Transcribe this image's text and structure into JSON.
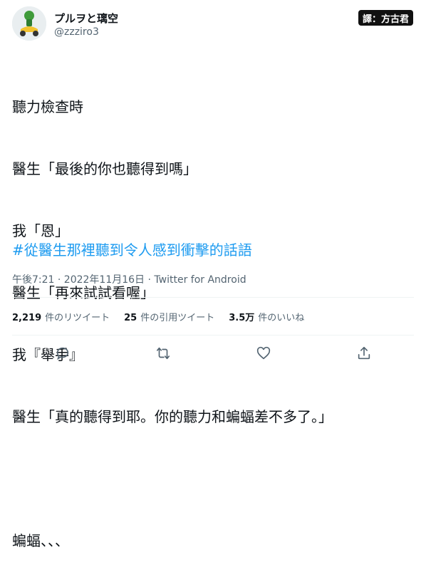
{
  "user": {
    "display_name": "プルヲと璃空",
    "handle": "@zzziro3",
    "avatar_icon": "scooter-character-avatar"
  },
  "watermark": {
    "label": "譯：方古君"
  },
  "tweet": {
    "lines": [
      "聽力檢查時",
      "醫生「最後的你也聽得到嗎」",
      "我「恩」",
      "醫生「再來試試看喔」",
      "我『舉手』",
      "醫生「真的聽得到耶。你的聽力和蝙蝠差不多了。」",
      "",
      "蝙蝠、、、"
    ],
    "hashtag": "#從醫生那裡聽到令人感到衝擊的話語",
    "timestamp": "午後7:21 · 2022年11月16日 · Twitter for Android"
  },
  "stats": {
    "retweets_count": "2,219",
    "retweets_label": "件のリツイート",
    "quotes_count": "25",
    "quotes_label": "件の引用ツイート",
    "likes_count": "3.5万",
    "likes_label": "件のいいね"
  },
  "actions": {
    "icons": [
      "reply-icon",
      "retweet-icon",
      "like-icon",
      "share-icon"
    ]
  },
  "colors": {
    "accent": "#1d9bf0",
    "secondary_text": "#536471",
    "primary_text": "#0f1419",
    "divider": "#eff3f4"
  }
}
